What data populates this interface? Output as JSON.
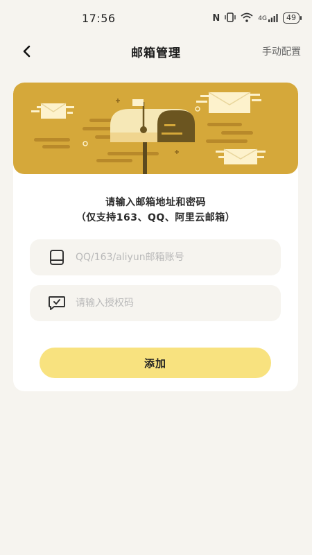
{
  "status_bar": {
    "time": "17:56",
    "nfc": "N",
    "network": "4G",
    "battery": "49"
  },
  "header": {
    "title": "邮箱管理",
    "manual_config": "手动配置"
  },
  "card": {
    "instruction_line1": "请输入邮箱地址和密码",
    "instruction_line2": "（仅支持163、QQ、阿里云邮箱）",
    "account_placeholder": "QQ/163/aliyun邮箱账号",
    "code_placeholder": "请输入授权码",
    "add_label": "添加"
  },
  "colors": {
    "banner": "#d5a83a",
    "button": "#f8e27f",
    "background": "#f6f4ef"
  }
}
